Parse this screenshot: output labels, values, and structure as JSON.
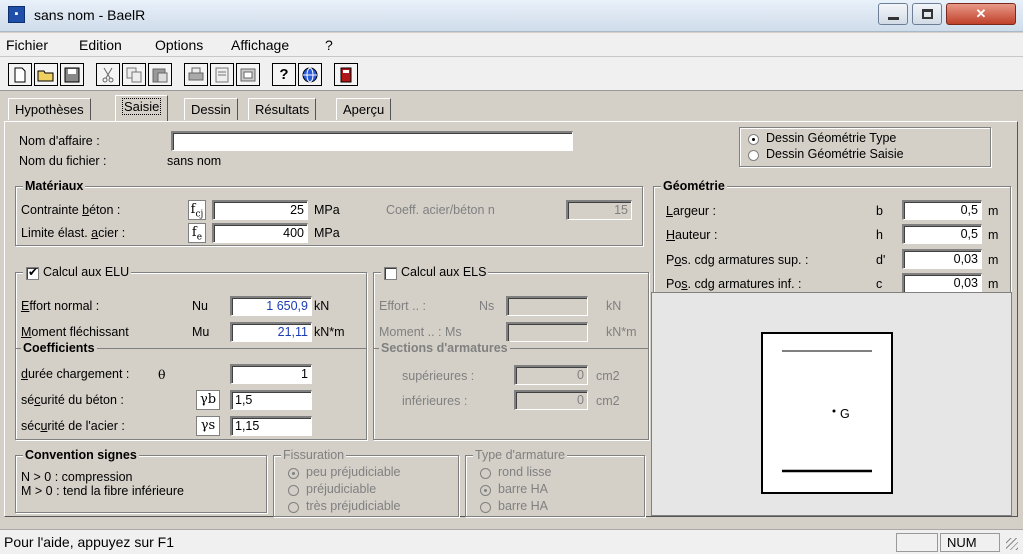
{
  "window": {
    "title": "sans nom - BaelR"
  },
  "menu": [
    "Fichier",
    "Edition",
    "Options",
    "Affichage",
    "?"
  ],
  "toolbar_icons": [
    "new-file-icon",
    "open-folder-icon",
    "save-icon",
    "cut-icon",
    "copy-icon",
    "paste-icon",
    "print-icon",
    "print-preview-icon",
    "page-setup-icon",
    "help-icon",
    "globe-icon",
    "calculator-icon"
  ],
  "tabs": [
    "Hypothèses",
    "Saisie",
    "Dessin",
    "Résultats",
    "Aperçu"
  ],
  "active_tab": "Saisie",
  "affaire": {
    "nom_label": "Nom d'affaire :",
    "nom_value": "",
    "fichier_label": "Nom du fichier :",
    "fichier_value": "sans nom"
  },
  "dessin_options": {
    "type": "Dessin Géométrie Type",
    "saisie": "Dessin Géométrie Saisie",
    "selected": "type"
  },
  "materiaux": {
    "title": "Matériaux",
    "beton_label": "Contrainte béton :",
    "beton_sym": "fcj",
    "beton_value": "25",
    "beton_unit": "MPa",
    "acier_label": "Limite élast. acier :",
    "acier_sym": "fe",
    "acier_value": "400",
    "acier_unit": "MPa",
    "coeff_label": "Coeff. acier/béton  n",
    "coeff_value": "15"
  },
  "geometrie": {
    "title": "Géométrie",
    "rows": [
      {
        "label": "Largeur :",
        "sym": "b",
        "value": "0,5",
        "unit": "m"
      },
      {
        "label": "Hauteur :",
        "sym": "h",
        "value": "0,5",
        "unit": "m"
      },
      {
        "label": "Pos. cdg armatures sup. :",
        "sym": "d'",
        "value": "0,03",
        "unit": "m"
      },
      {
        "label": "Pos. cdg armatures inf. :",
        "sym": "c",
        "value": "0,03",
        "unit": "m"
      }
    ]
  },
  "elu": {
    "title": "Calcul aux ELU",
    "checked": true,
    "effort_label": "Effort normal :",
    "effort_sym": "Nu",
    "effort_value": "1 650,9",
    "effort_unit": "kN",
    "moment_label": "Moment fléchissant",
    "moment_sym": "Mu",
    "moment_value": "21,11",
    "moment_unit": "kN*m"
  },
  "els": {
    "title": "Calcul aux ELS",
    "checked": false,
    "effort_label": "Effort .. :",
    "effort_sym": "Ns",
    "effort_unit": "kN",
    "moment_label": "Moment .. : Ms",
    "moment_unit": "kN*m"
  },
  "coefficients": {
    "title": "Coefficients",
    "duree_label": "durée chargement :",
    "duree_sym": "θ",
    "duree_value": "1",
    "beton_label": "sécurité du béton :",
    "beton_sym": "γb",
    "beton_value": "1,5",
    "acier_label": "sécurité de l'acier :",
    "acier_sym": "γs",
    "acier_value": "1,15"
  },
  "sections": {
    "title": "Sections d'armatures",
    "sup_label": "supérieures :",
    "sup_value": "0",
    "inf_label": "inférieures :",
    "inf_value": "0",
    "unit": "cm2"
  },
  "convention": {
    "title": "Convention signes",
    "line1": "N > 0 : compression",
    "line2": "M > 0 : tend la fibre inférieure"
  },
  "fissuration": {
    "title": "Fissuration",
    "options": [
      "peu préjudiciable",
      "préjudiciable",
      "très préjudiciable"
    ],
    "selected": 0
  },
  "armature": {
    "title": "Type d'armature",
    "options": [
      "rond lisse",
      "barre HA",
      "barre HA"
    ],
    "selected": 1
  },
  "drawing": {
    "label": "G"
  },
  "status": {
    "text": "Pour l'aide, appuyez sur F1",
    "num": "NUM"
  }
}
